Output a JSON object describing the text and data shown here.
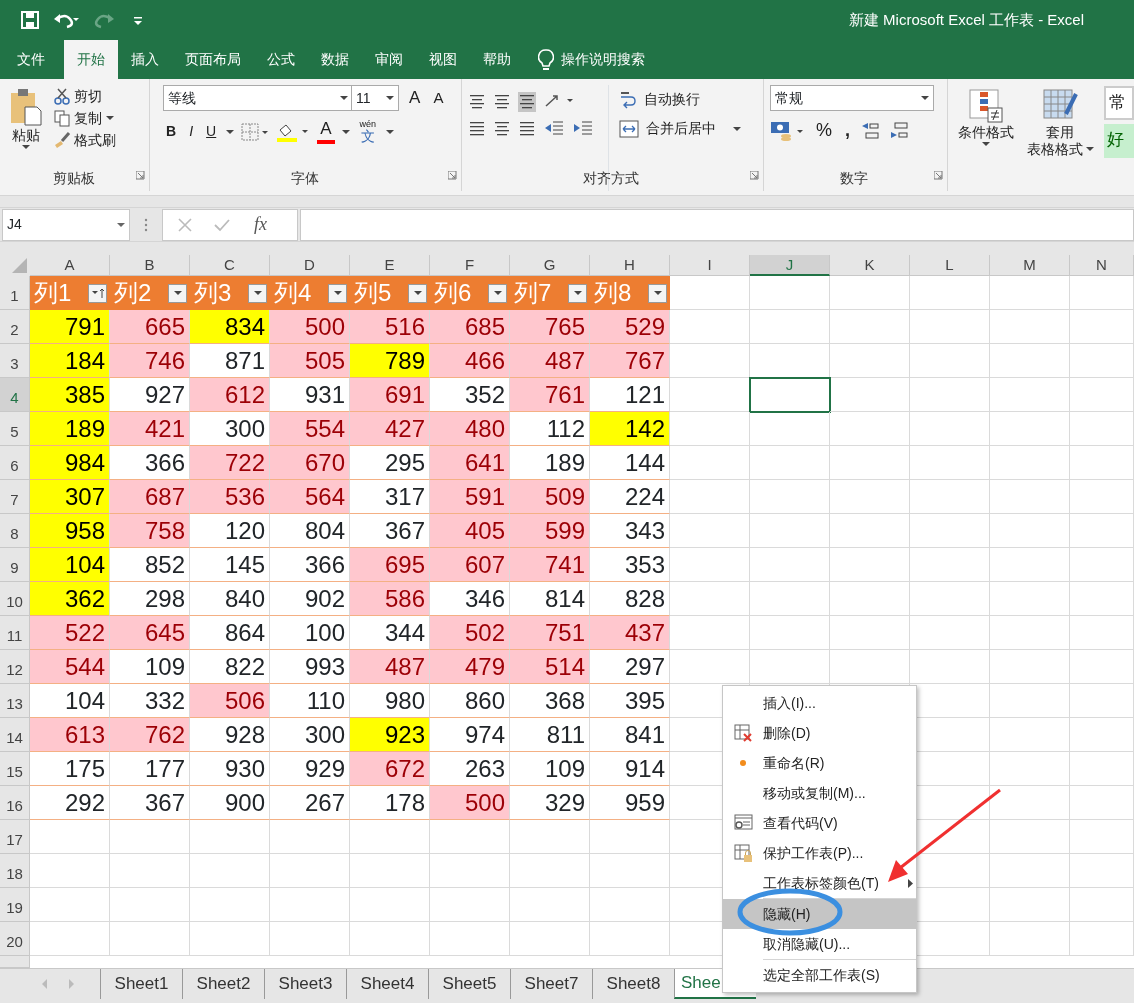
{
  "window": {
    "title": "新建 Microsoft Excel 工作表  -  Excel"
  },
  "ribbon_tabs": [
    {
      "label": "文件",
      "selected": false
    },
    {
      "label": "开始",
      "selected": true
    },
    {
      "label": "插入",
      "selected": false
    },
    {
      "label": "页面布局",
      "selected": false
    },
    {
      "label": "公式",
      "selected": false
    },
    {
      "label": "数据",
      "selected": false
    },
    {
      "label": "审阅",
      "selected": false
    },
    {
      "label": "视图",
      "selected": false
    },
    {
      "label": "帮助",
      "selected": false
    }
  ],
  "tell_me": {
    "placeholder": "操作说明搜索"
  },
  "clipboard": {
    "paste": "粘贴",
    "cut": "剪切",
    "copy": "复制",
    "format_painter": "格式刷",
    "group_label": "剪贴板"
  },
  "font": {
    "name": "等线",
    "size": "11",
    "grow": "A",
    "shrink": "A",
    "bold": "B",
    "italic": "I",
    "underline": "U",
    "font_color": "A",
    "phonetic_top": "wén",
    "phonetic_bottom": "文",
    "group_label": "字体"
  },
  "alignment": {
    "wrap_text": "自动换行",
    "merge_center": "合并后居中",
    "group_label": "对齐方式"
  },
  "number": {
    "format": "常规",
    "percent": "%",
    "comma": ",",
    "group_label": "数字"
  },
  "styles": {
    "conditional_format": "条件格式",
    "table_format_top": "套用",
    "table_format_bottom": "表格格式",
    "style_normal": "常",
    "style_good": "好"
  },
  "formula_bar": {
    "name_box": "J4",
    "fx": "fx"
  },
  "columns": [
    {
      "label": "A",
      "selected": false
    },
    {
      "label": "B",
      "selected": false
    },
    {
      "label": "C",
      "selected": false
    },
    {
      "label": "D",
      "selected": false
    },
    {
      "label": "E",
      "selected": false
    },
    {
      "label": "F",
      "selected": false
    },
    {
      "label": "G",
      "selected": false
    },
    {
      "label": "H",
      "selected": false
    },
    {
      "label": "I",
      "selected": false
    },
    {
      "label": "J",
      "selected": true
    },
    {
      "label": "K",
      "selected": false
    },
    {
      "label": "L",
      "selected": false
    },
    {
      "label": "M",
      "selected": false
    },
    {
      "label": "N",
      "selected": false
    }
  ],
  "table_headers": [
    {
      "label": "列1",
      "sorted": true
    },
    {
      "label": "列2",
      "sorted": false
    },
    {
      "label": "列3",
      "sorted": false
    },
    {
      "label": "列4",
      "sorted": false
    },
    {
      "label": "列5",
      "sorted": false
    },
    {
      "label": "列6",
      "sorted": false
    },
    {
      "label": "列7",
      "sorted": false
    },
    {
      "label": "列8",
      "sorted": false
    }
  ],
  "rows": [
    {
      "number": "1",
      "selected": false
    },
    {
      "number": "2",
      "selected": false,
      "cells": [
        {
          "value": "791",
          "color": "#ffff00"
        },
        {
          "value": "665",
          "color": "#ffc7ce"
        },
        {
          "value": "834",
          "color": "#ffff00"
        },
        {
          "value": "500",
          "color": "#ffc7ce"
        },
        {
          "value": "516",
          "color": "#ffc7ce"
        },
        {
          "value": "685",
          "color": "#ffc7ce"
        },
        {
          "value": "765",
          "color": "#ffc7ce"
        },
        {
          "value": "529",
          "color": "#ffc7ce"
        }
      ]
    },
    {
      "number": "3",
      "selected": false,
      "cells": [
        {
          "value": "184",
          "color": "#ffff00"
        },
        {
          "value": "746",
          "color": "#ffc7ce"
        },
        {
          "value": "871"
        },
        {
          "value": "505",
          "color": "#ffc7ce"
        },
        {
          "value": "789",
          "color": "#ffff00"
        },
        {
          "value": "466",
          "color": "#ffc7ce"
        },
        {
          "value": "487",
          "color": "#ffc7ce"
        },
        {
          "value": "767",
          "color": "#ffc7ce"
        }
      ]
    },
    {
      "number": "4",
      "selected": true,
      "cells": [
        {
          "value": "385",
          "color": "#ffff00"
        },
        {
          "value": "927"
        },
        {
          "value": "612",
          "color": "#ffc7ce"
        },
        {
          "value": "931"
        },
        {
          "value": "691",
          "color": "#ffc7ce"
        },
        {
          "value": "352"
        },
        {
          "value": "761",
          "color": "#ffc7ce"
        },
        {
          "value": "121"
        }
      ]
    },
    {
      "number": "5",
      "selected": false,
      "cells": [
        {
          "value": "189",
          "color": "#ffff00"
        },
        {
          "value": "421",
          "color": "#ffc7ce"
        },
        {
          "value": "300"
        },
        {
          "value": "554",
          "color": "#ffc7ce"
        },
        {
          "value": "427",
          "color": "#ffc7ce"
        },
        {
          "value": "480",
          "color": "#ffc7ce"
        },
        {
          "value": "112"
        },
        {
          "value": "142",
          "color": "#ffff00"
        }
      ]
    },
    {
      "number": "6",
      "selected": false,
      "cells": [
        {
          "value": "984",
          "color": "#ffff00"
        },
        {
          "value": "366"
        },
        {
          "value": "722",
          "color": "#ffc7ce"
        },
        {
          "value": "670",
          "color": "#ffc7ce"
        },
        {
          "value": "295"
        },
        {
          "value": "641",
          "color": "#ffc7ce"
        },
        {
          "value": "189"
        },
        {
          "value": "144"
        }
      ]
    },
    {
      "number": "7",
      "selected": false,
      "cells": [
        {
          "value": "307",
          "color": "#ffff00"
        },
        {
          "value": "687",
          "color": "#ffc7ce"
        },
        {
          "value": "536",
          "color": "#ffc7ce"
        },
        {
          "value": "564",
          "color": "#ffc7ce"
        },
        {
          "value": "317"
        },
        {
          "value": "591",
          "color": "#ffc7ce"
        },
        {
          "value": "509",
          "color": "#ffc7ce"
        },
        {
          "value": "224"
        }
      ]
    },
    {
      "number": "8",
      "selected": false,
      "cells": [
        {
          "value": "958",
          "color": "#ffff00"
        },
        {
          "value": "758",
          "color": "#ffc7ce"
        },
        {
          "value": "120"
        },
        {
          "value": "804"
        },
        {
          "value": "367"
        },
        {
          "value": "405",
          "color": "#ffc7ce"
        },
        {
          "value": "599",
          "color": "#ffc7ce"
        },
        {
          "value": "343"
        }
      ]
    },
    {
      "number": "9",
      "selected": false,
      "cells": [
        {
          "value": "104",
          "color": "#ffff00"
        },
        {
          "value": "852"
        },
        {
          "value": "145"
        },
        {
          "value": "366"
        },
        {
          "value": "695",
          "color": "#ffc7ce"
        },
        {
          "value": "607",
          "color": "#ffc7ce"
        },
        {
          "value": "741",
          "color": "#ffc7ce"
        },
        {
          "value": "353"
        }
      ]
    },
    {
      "number": "10",
      "selected": false,
      "cells": [
        {
          "value": "362",
          "color": "#ffff00"
        },
        {
          "value": "298"
        },
        {
          "value": "840"
        },
        {
          "value": "902"
        },
        {
          "value": "586",
          "color": "#ffc7ce"
        },
        {
          "value": "346"
        },
        {
          "value": "814"
        },
        {
          "value": "828"
        }
      ]
    },
    {
      "number": "11",
      "selected": false,
      "cells": [
        {
          "value": "522",
          "color": "#ffc7ce"
        },
        {
          "value": "645",
          "color": "#ffc7ce"
        },
        {
          "value": "864"
        },
        {
          "value": "100"
        },
        {
          "value": "344"
        },
        {
          "value": "502",
          "color": "#ffc7ce"
        },
        {
          "value": "751",
          "color": "#ffc7ce"
        },
        {
          "value": "437",
          "color": "#ffc7ce"
        }
      ]
    },
    {
      "number": "12",
      "selected": false,
      "cells": [
        {
          "value": "544",
          "color": "#ffc7ce"
        },
        {
          "value": "109"
        },
        {
          "value": "822"
        },
        {
          "value": "993"
        },
        {
          "value": "487",
          "color": "#ffc7ce"
        },
        {
          "value": "479",
          "color": "#ffc7ce"
        },
        {
          "value": "514",
          "color": "#ffc7ce"
        },
        {
          "value": "297"
        }
      ]
    },
    {
      "number": "13",
      "selected": false,
      "cells": [
        {
          "value": "104"
        },
        {
          "value": "332"
        },
        {
          "value": "506",
          "color": "#ffc7ce"
        },
        {
          "value": "110"
        },
        {
          "value": "980"
        },
        {
          "value": "860"
        },
        {
          "value": "368"
        },
        {
          "value": "395"
        }
      ]
    },
    {
      "number": "14",
      "selected": false,
      "cells": [
        {
          "value": "613",
          "color": "#ffc7ce"
        },
        {
          "value": "762",
          "color": "#ffc7ce"
        },
        {
          "value": "928"
        },
        {
          "value": "300"
        },
        {
          "value": "923",
          "color": "#ffff00"
        },
        {
          "value": "974"
        },
        {
          "value": "811"
        },
        {
          "value": "841"
        }
      ]
    },
    {
      "number": "15",
      "selected": false,
      "cells": [
        {
          "value": "175"
        },
        {
          "value": "177"
        },
        {
          "value": "930"
        },
        {
          "value": "929"
        },
        {
          "value": "672",
          "color": "#ffc7ce"
        },
        {
          "value": "263"
        },
        {
          "value": "109"
        },
        {
          "value": "914"
        }
      ]
    },
    {
      "number": "16",
      "selected": false,
      "cells": [
        {
          "value": "292"
        },
        {
          "value": "367"
        },
        {
          "value": "900"
        },
        {
          "value": "267"
        },
        {
          "value": "178"
        },
        {
          "value": "500",
          "color": "#ffc7ce"
        },
        {
          "value": "329"
        },
        {
          "value": "959"
        }
      ]
    },
    {
      "number": "17",
      "selected": false
    },
    {
      "number": "18",
      "selected": false
    },
    {
      "number": "19",
      "selected": false
    },
    {
      "number": "20",
      "selected": false
    }
  ],
  "sheet_tabs": [
    {
      "label": "Sheet1",
      "selected": false
    },
    {
      "label": "Sheet2",
      "selected": false
    },
    {
      "label": "Sheet3",
      "selected": false
    },
    {
      "label": "Sheet4",
      "selected": false
    },
    {
      "label": "Sheet5",
      "selected": false
    },
    {
      "label": "Sheet7",
      "selected": false
    },
    {
      "label": "Sheet8",
      "selected": false
    },
    {
      "label": "Shee",
      "selected": true
    }
  ],
  "context_menu": [
    {
      "label": "插入(I)...",
      "kind": "plain",
      "selected": false
    },
    {
      "label": "删除(D)",
      "kind": "delete",
      "selected": false
    },
    {
      "label": "重命名(R)",
      "kind": "dot",
      "selected": false
    },
    {
      "label": "移动或复制(M)...",
      "kind": "plain",
      "selected": false
    },
    {
      "label": "查看代码(V)",
      "kind": "code",
      "selected": false
    },
    {
      "label": "保护工作表(P)...",
      "kind": "protect",
      "selected": false
    },
    {
      "label": "工作表标签颜色(T)",
      "kind": "submenu",
      "selected": false
    },
    {
      "label": "隐藏(H)",
      "kind": "plain",
      "selected": true,
      "divider_above": true
    },
    {
      "label": "取消隐藏(U)...",
      "kind": "plain",
      "selected": false
    },
    {
      "label": "选定全部工作表(S)",
      "kind": "plain",
      "selected": false,
      "divider_above": true
    }
  ]
}
